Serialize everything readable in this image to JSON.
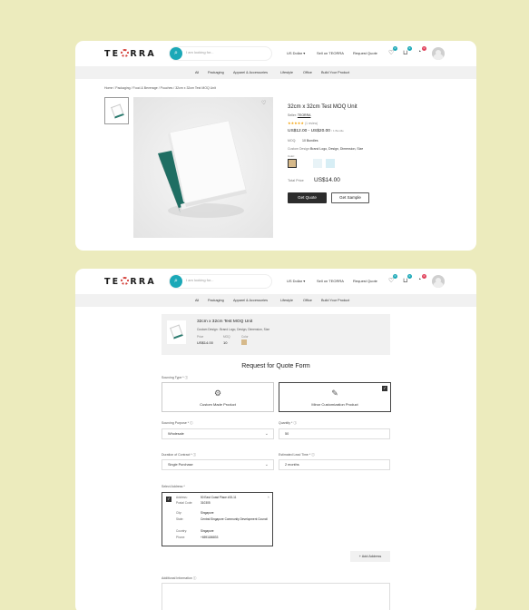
{
  "header": {
    "logo_left": "TE",
    "logo_right": "RRA",
    "search_placeholder": "I am looking for...",
    "currency": "US Dollar",
    "sell_link": "Sell on TEORRA",
    "request_quote": "Request Quote",
    "badges": {
      "wishlist": "0",
      "cart": "0",
      "notifications": "0"
    }
  },
  "nav": [
    "All",
    "Packaging",
    "Apparel & Accessories",
    "Lifestyle",
    "Office",
    "Build Your Product"
  ],
  "breadcrumb": "Home  /  Packaging  /  Food & Beverage  /  Pouches  /  32cm x 32cm Test MOQ Unit",
  "product": {
    "title": "32cm x 32cm Test MOQ Unit",
    "seller_label": "Seller:",
    "seller_name": "TEORRA",
    "stars": "★★★★★",
    "reviews": "(1 review)",
    "price_range": "US$12.00 - US$20.00",
    "price_unit": "/ 1 Bundle",
    "specs": [
      {
        "k": "MOQ:",
        "v": "10 Bundles"
      },
      {
        "k": "Custom Design:",
        "v": "Brand Logo, Design, Dimension, Size"
      }
    ],
    "color_label": "Color:",
    "swatches": [
      "#d6b98a",
      "#ffffff",
      "#e8f3f7",
      "#d7eef5"
    ],
    "total_label": "Total Price",
    "total_value": "US$14.00",
    "get_quote": "Get Quote",
    "get_sample": "Get Sample"
  },
  "summary": {
    "title": "32cm x 32cm Test MOQ Unit",
    "desc": "Custom Design :  Brand Logo, Design, Dimension, Size",
    "price_label": "Price",
    "price_value": "US$14.00",
    "moq_label": "MOQ",
    "moq_value": "10",
    "color_label": "Color",
    "color": "#d6b98a"
  },
  "form": {
    "title": "Request for Quote Form",
    "sourcing_type_label": "Sourcing Type *",
    "type_custom": "Custom Made Product",
    "type_minor": "Minor Customization Product",
    "purpose_label": "Sourcing Purpose *",
    "purpose_value": "Wholesale",
    "quantity_label": "Quantity *",
    "quantity_value": "50",
    "duration_label": "Duration of Contract *",
    "duration_value": "Single Purchase",
    "lead_label": "Estimated Lead Time *",
    "lead_value": "2 months",
    "address_label": "Select Address *",
    "address": [
      {
        "k": "Address:",
        "v": "50 East Coast Place #15-11"
      },
      {
        "k": "Postal Code:",
        "v": "310305"
      },
      {
        "k": "City:",
        "v": "Singapore"
      },
      {
        "k": "State:",
        "v": "Central Singapore Community Development Council"
      },
      {
        "k": "Country:",
        "v": "Singapore"
      },
      {
        "k": "Phone:",
        "v": "+6591186833"
      }
    ],
    "add_address": "Add Address",
    "additional_label": "Additional Information"
  }
}
